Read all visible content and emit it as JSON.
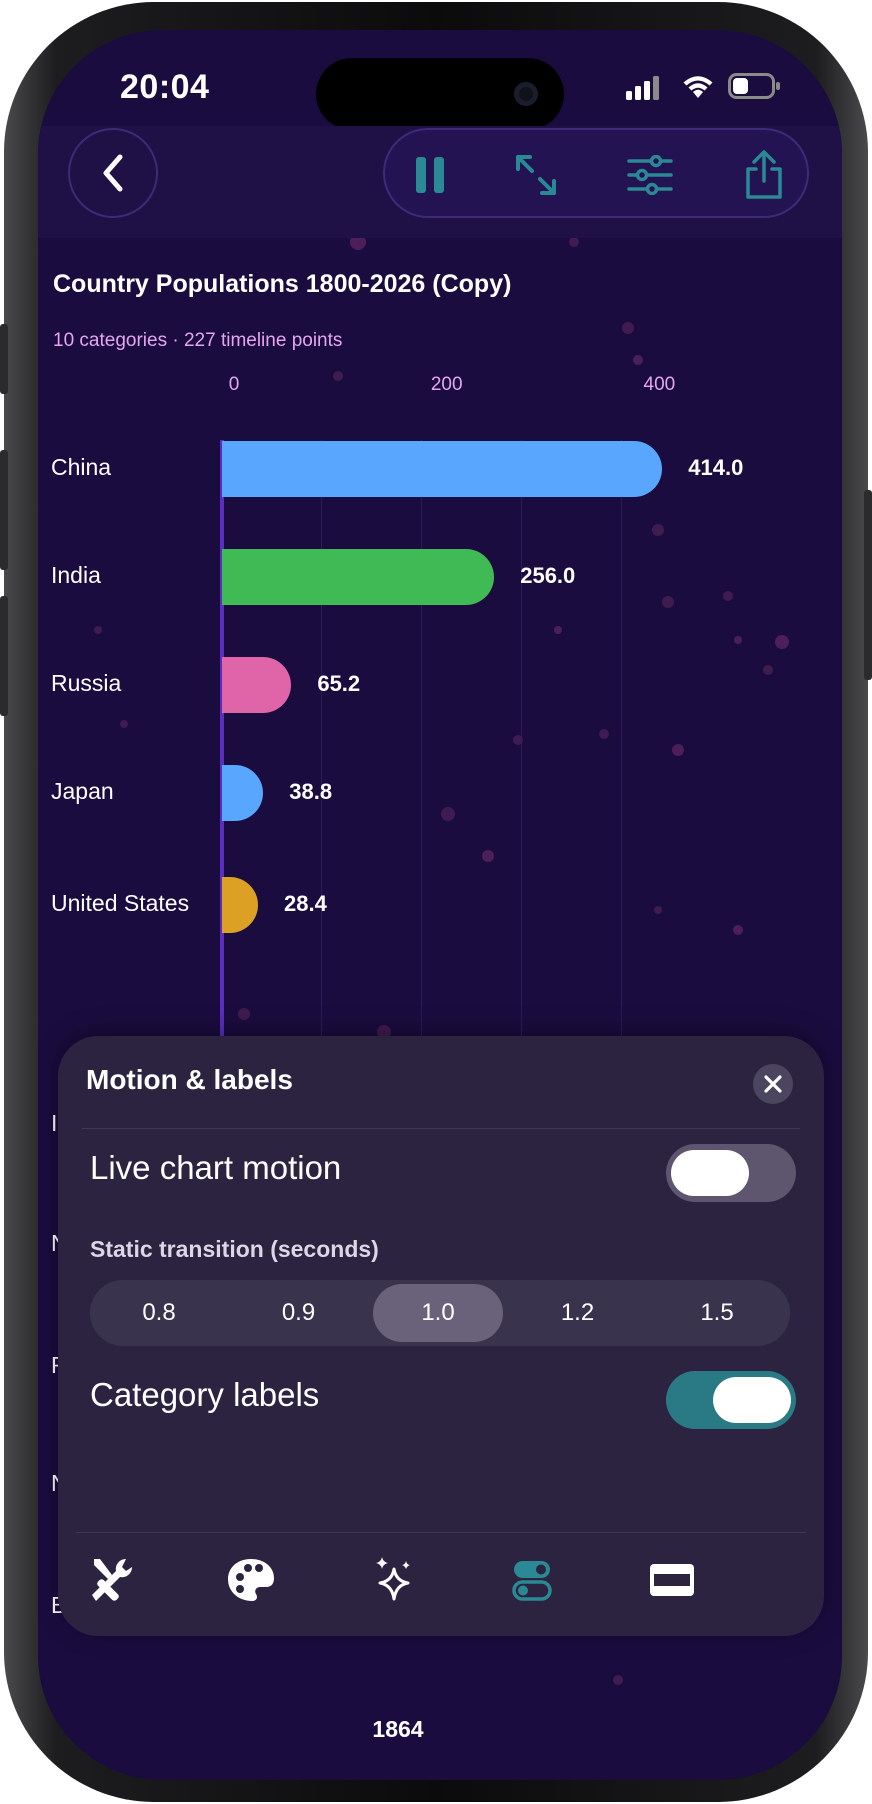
{
  "status": {
    "time": "20:04"
  },
  "chart_data": {
    "type": "bar",
    "title": "Country Populations 1800-2026 (Copy)",
    "subtitle": "10 categories · 227 timeline points",
    "x_ticks": [
      "0",
      "200",
      "400"
    ],
    "xlim": [
      0,
      410
    ],
    "categories": [
      "China",
      "India",
      "Russia",
      "Japan",
      "United States"
    ],
    "values": [
      414.0,
      256.0,
      65.2,
      38.8,
      28.4
    ],
    "value_labels": [
      "414.0",
      "256.0",
      "65.2",
      "38.8",
      "28.4"
    ],
    "colors": [
      "#58a6fd",
      "#3fba55",
      "#e065a8",
      "#58a6fd",
      "#dba024"
    ],
    "partially_hidden_labels": [
      "I",
      "N",
      "F",
      "N",
      "B"
    ],
    "current_year": "1864"
  },
  "sheet": {
    "title": "Motion & labels",
    "live_motion_label": "Live chart motion",
    "live_motion_on": false,
    "transition_label": "Static transition (seconds)",
    "transition_options": [
      "0.8",
      "0.9",
      "1.0",
      "1.2",
      "1.5"
    ],
    "transition_selected": "1.0",
    "category_labels_label": "Category labels",
    "category_labels_on": true,
    "tabs": [
      "tools-icon",
      "palette-icon",
      "sparkles-icon",
      "toggles-icon",
      "display-icon"
    ],
    "active_tab": "toggles-icon"
  },
  "colors": {
    "background": "#1b0c3f",
    "accent": "#2a7a86",
    "label_pink": "#e5a6ee"
  }
}
